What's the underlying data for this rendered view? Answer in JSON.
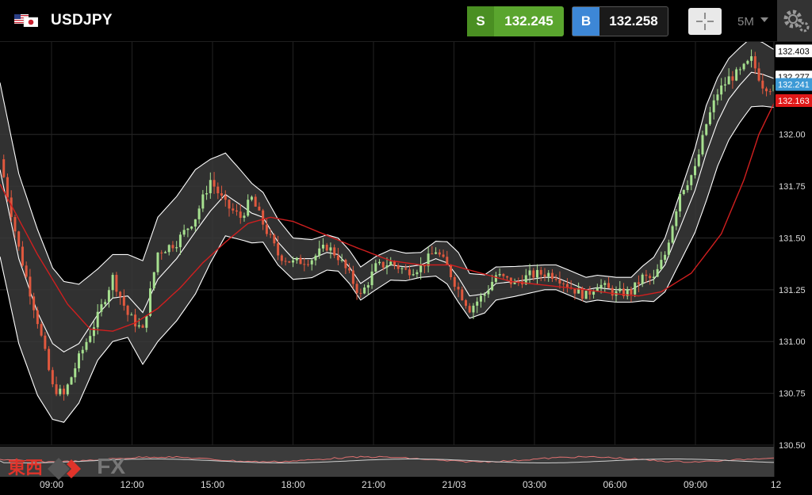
{
  "header": {
    "symbol": "USDJPY",
    "sell_label": "S",
    "sell_price": "132.245",
    "buy_label": "B",
    "buy_price": "132.258",
    "timeframe": "5M",
    "icons": [
      "us-jp-flag-icon",
      "crosshair-icon",
      "chevron-down-icon",
      "gear-icon"
    ]
  },
  "logo": {
    "text": "東西",
    "fx": "FX"
  },
  "chart_data": {
    "type": "candlestick",
    "title": "",
    "ylim": [
      130.5,
      132.45
    ],
    "y_ticks": [
      "132.00",
      "131.75",
      "131.50",
      "131.25",
      "131.00",
      "130.75",
      "130.50"
    ],
    "x_labels": [
      "09:00",
      "12:00",
      "15:00",
      "18:00",
      "21:00",
      "21/03",
      "03:00",
      "06:00",
      "09:00",
      "12"
    ],
    "price_tags": [
      {
        "label": "132.403",
        "value": 132.403,
        "color": "#ffffff",
        "text_color": "#000000"
      },
      {
        "label": "132.277",
        "value": 132.277,
        "color": "#ffffff",
        "text_color": "#000000"
      },
      {
        "label": "132.241",
        "value": 132.241,
        "color": "#3d9ad6",
        "text_color": "#ffffff"
      },
      {
        "label": "132.163",
        "value": 132.163,
        "color": "#e01818",
        "text_color": "#ffffff"
      }
    ],
    "close_path": [
      [
        0,
        131.88
      ],
      [
        5,
        131.45
      ],
      [
        10,
        131.1
      ],
      [
        14,
        130.78
      ],
      [
        17,
        130.74
      ],
      [
        21,
        130.92
      ],
      [
        26,
        131.12
      ],
      [
        30,
        131.31
      ],
      [
        34,
        131.13
      ],
      [
        38,
        131.05
      ],
      [
        42,
        131.43
      ],
      [
        47,
        131.48
      ],
      [
        52,
        131.6
      ],
      [
        56,
        131.78
      ],
      [
        60,
        131.66
      ],
      [
        64,
        131.6
      ],
      [
        67,
        131.69
      ],
      [
        70,
        131.57
      ],
      [
        74,
        131.42
      ],
      [
        78,
        131.38
      ],
      [
        83,
        131.4
      ],
      [
        87,
        131.46
      ],
      [
        90,
        131.41
      ],
      [
        93,
        131.32
      ],
      [
        96,
        131.22
      ],
      [
        100,
        131.36
      ],
      [
        104,
        131.38
      ],
      [
        108,
        131.34
      ],
      [
        112,
        131.36
      ],
      [
        116,
        131.44
      ],
      [
        119,
        131.36
      ],
      [
        122,
        131.25
      ],
      [
        125,
        131.16
      ],
      [
        129,
        131.23
      ],
      [
        132,
        131.32
      ],
      [
        137,
        131.28
      ],
      [
        141,
        131.32
      ],
      [
        145,
        131.33
      ],
      [
        148,
        131.32
      ],
      [
        152,
        131.26
      ],
      [
        156,
        131.22
      ],
      [
        159,
        131.28
      ],
      [
        164,
        131.23
      ],
      [
        168,
        131.24
      ],
      [
        171,
        131.31
      ],
      [
        174,
        131.3
      ],
      [
        177,
        131.42
      ],
      [
        181,
        131.72
      ],
      [
        185,
        131.83
      ],
      [
        188,
        132.05
      ],
      [
        191,
        132.2
      ],
      [
        194,
        132.27
      ],
      [
        197,
        132.3
      ],
      [
        200,
        132.36
      ],
      [
        203,
        132.24
      ],
      [
        206,
        132.22
      ]
    ],
    "mid_band": [
      [
        0,
        131.83
      ],
      [
        5,
        131.4
      ],
      [
        10,
        131.14
      ],
      [
        14,
        130.99
      ],
      [
        17,
        130.95
      ],
      [
        21,
        130.99
      ],
      [
        26,
        131.13
      ],
      [
        30,
        131.21
      ],
      [
        34,
        131.22
      ],
      [
        38,
        131.14
      ],
      [
        42,
        131.3
      ],
      [
        47,
        131.4
      ],
      [
        52,
        131.53
      ],
      [
        56,
        131.63
      ],
      [
        60,
        131.71
      ],
      [
        64,
        131.66
      ],
      [
        67,
        131.62
      ],
      [
        70,
        131.6
      ],
      [
        74,
        131.48
      ],
      [
        78,
        131.4
      ],
      [
        83,
        131.4
      ],
      [
        87,
        131.43
      ],
      [
        90,
        131.42
      ],
      [
        93,
        131.36
      ],
      [
        96,
        131.28
      ],
      [
        100,
        131.33
      ],
      [
        104,
        131.37
      ],
      [
        108,
        131.36
      ],
      [
        112,
        131.37
      ],
      [
        116,
        131.4
      ],
      [
        119,
        131.38
      ],
      [
        122,
        131.31
      ],
      [
        125,
        131.22
      ],
      [
        129,
        131.23
      ],
      [
        132,
        131.28
      ],
      [
        137,
        131.29
      ],
      [
        141,
        131.3
      ],
      [
        145,
        131.31
      ],
      [
        148,
        131.31
      ],
      [
        152,
        131.28
      ],
      [
        156,
        131.25
      ],
      [
        159,
        131.26
      ],
      [
        164,
        131.25
      ],
      [
        168,
        131.25
      ],
      [
        171,
        131.28
      ],
      [
        174,
        131.3
      ],
      [
        177,
        131.37
      ],
      [
        181,
        131.55
      ],
      [
        185,
        131.73
      ],
      [
        188,
        131.91
      ],
      [
        191,
        132.06
      ],
      [
        194,
        132.17
      ],
      [
        197,
        132.24
      ],
      [
        200,
        132.3
      ],
      [
        203,
        132.29
      ],
      [
        206,
        132.27
      ]
    ],
    "band_width": [
      [
        0,
        0.42
      ],
      [
        10,
        0.4
      ],
      [
        17,
        0.34
      ],
      [
        26,
        0.22
      ],
      [
        34,
        0.2
      ],
      [
        42,
        0.3
      ],
      [
        52,
        0.3
      ],
      [
        60,
        0.2
      ],
      [
        70,
        0.12
      ],
      [
        78,
        0.1
      ],
      [
        90,
        0.08
      ],
      [
        100,
        0.08
      ],
      [
        112,
        0.06
      ],
      [
        122,
        0.12
      ],
      [
        132,
        0.08
      ],
      [
        145,
        0.06
      ],
      [
        156,
        0.06
      ],
      [
        168,
        0.06
      ],
      [
        177,
        0.13
      ],
      [
        188,
        0.23
      ],
      [
        197,
        0.18
      ],
      [
        206,
        0.14
      ]
    ],
    "ma_line": [
      [
        0,
        131.76
      ],
      [
        10,
        131.42
      ],
      [
        18,
        131.18
      ],
      [
        24,
        131.06
      ],
      [
        30,
        131.05
      ],
      [
        36,
        131.09
      ],
      [
        42,
        131.16
      ],
      [
        48,
        131.26
      ],
      [
        54,
        131.38
      ],
      [
        60,
        131.48
      ],
      [
        66,
        131.57
      ],
      [
        72,
        131.6
      ],
      [
        78,
        131.58
      ],
      [
        86,
        131.52
      ],
      [
        94,
        131.46
      ],
      [
        104,
        131.39
      ],
      [
        112,
        131.37
      ],
      [
        120,
        131.37
      ],
      [
        128,
        131.33
      ],
      [
        136,
        131.29
      ],
      [
        146,
        131.27
      ],
      [
        156,
        131.25
      ],
      [
        164,
        131.23
      ],
      [
        170,
        131.22
      ],
      [
        176,
        131.24
      ],
      [
        184,
        131.33
      ],
      [
        192,
        131.52
      ],
      [
        198,
        131.78
      ],
      [
        202,
        132.0
      ],
      [
        206,
        132.15
      ]
    ],
    "colors": {
      "up": "#a6e08f",
      "down": "#e0583e",
      "band": "#ffffff",
      "ma": "#d01f1f",
      "band_fill": "#3a3a3a"
    }
  }
}
